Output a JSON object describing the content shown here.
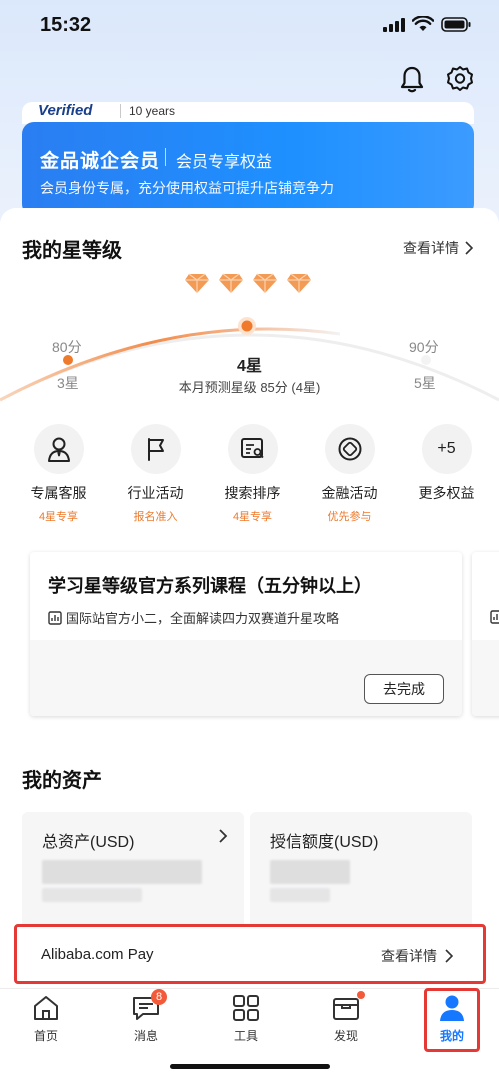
{
  "status_bar": {
    "time": "15:32"
  },
  "header": {
    "bell": "bell-icon",
    "settings": "gear-icon"
  },
  "verified": {
    "logo": "Verified",
    "years": "10 years"
  },
  "member": {
    "title": "金品诚企会员",
    "subtitle": "会员专享权益",
    "description": "会员身份专属，充分使用权益可提升店铺竞争力"
  },
  "star_level": {
    "title": "我的星等级",
    "view_detail": "查看详情",
    "left_score": "80分",
    "left_level": "3星",
    "right_score": "90分",
    "right_level": "5星",
    "current_level": "4星",
    "forecast": "本月预测星级 85分 (4星)",
    "diamond_count": 4,
    "accent_color": "#f07a2b"
  },
  "benefits": [
    {
      "name": "专属客服",
      "tag": "4星专享",
      "icon": "customer-service-icon"
    },
    {
      "name": "行业活动",
      "tag": "报名准入",
      "icon": "flag-icon"
    },
    {
      "name": "搜索排序",
      "tag": "4星专享",
      "icon": "search-rank-icon"
    },
    {
      "name": "金融活动",
      "tag": "优先参与",
      "icon": "finance-icon"
    },
    {
      "name": "更多权益",
      "tag": "",
      "icon_text": "+5"
    }
  ],
  "course": {
    "title": "学习星等级官方系列课程（五分钟以上）",
    "description": "国际站官方小二，全面解读四力双赛道升星攻略",
    "button": "去完成"
  },
  "assets": {
    "title": "我的资产",
    "total_assets": "总资产(USD)",
    "credit_limit": "授信额度(USD)",
    "pay_label": "Alibaba.com Pay",
    "pay_detail": "查看详情"
  },
  "tabbar": {
    "items": [
      {
        "label": "首页",
        "icon": "home-icon"
      },
      {
        "label": "消息",
        "icon": "message-icon",
        "badge": "8"
      },
      {
        "label": "工具",
        "icon": "grid-icon"
      },
      {
        "label": "发现",
        "icon": "discover-icon"
      },
      {
        "label": "我的",
        "icon": "profile-icon"
      }
    ],
    "active_color": "#1677ff"
  }
}
